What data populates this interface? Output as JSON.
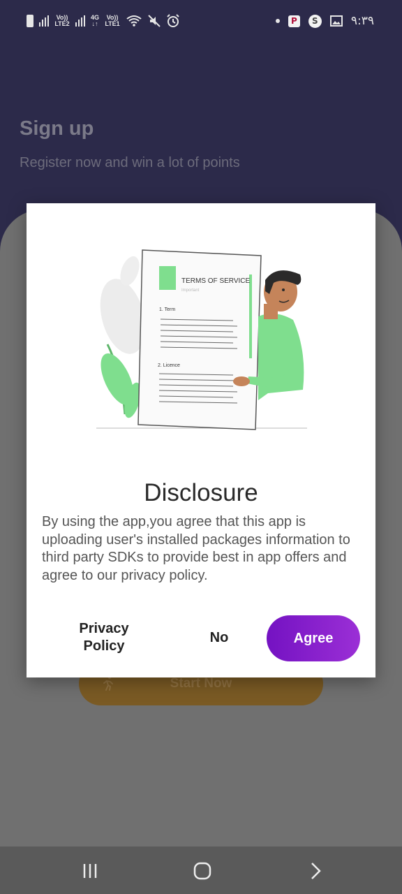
{
  "status_bar": {
    "net1": "Vo)) LTE2",
    "net2_top": "4G",
    "net2_bottom": "↓↑",
    "net3": "Vo)) LTE1",
    "app_icon_p": "P",
    "app_icon_s": "S",
    "time": "٩:٣٩"
  },
  "background": {
    "title": "Sign up",
    "subtitle": "Register now and win a lot of points",
    "start_button": "Start Now"
  },
  "illustration": {
    "doc_title": "TERMS OF SERVICE",
    "doc_sub": "Important",
    "section1": "1. Term",
    "section2": "2. Licence"
  },
  "dialog": {
    "title": "Disclosure",
    "body": "By using the app,you agree that this app is uploading user's installed packages information to third party SDKs to provide best in app offers and agree to our privacy policy.",
    "privacy_line1": "Privacy",
    "privacy_line2": "Policy",
    "no_label": "No",
    "agree_label": "Agree"
  },
  "colors": {
    "header_bg": "#2c2a4a",
    "agree_gradient_start": "#7412c2",
    "agree_gradient_end": "#9b2fd6",
    "illustration_green": "#7fde8e"
  },
  "navigation": {
    "recents": "recents-icon",
    "home": "home-icon",
    "back": "back-icon"
  }
}
